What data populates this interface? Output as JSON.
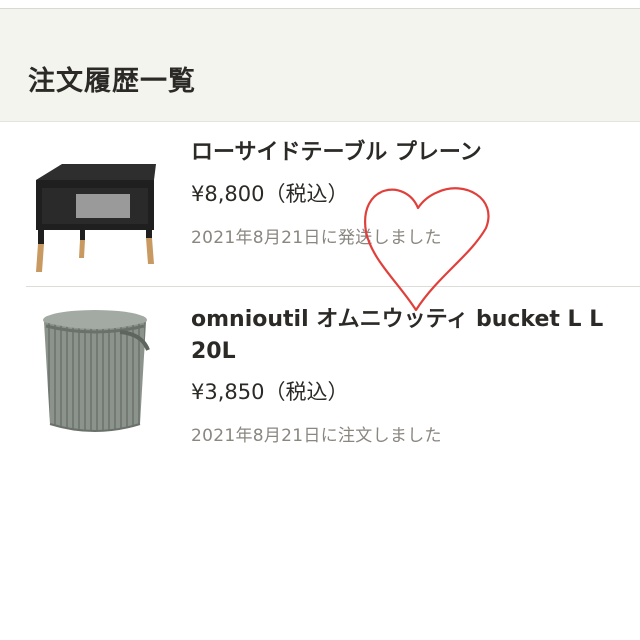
{
  "page": {
    "title": "注文履歴一覧"
  },
  "orders": [
    {
      "name": "ローサイドテーブル プレーン",
      "price": "¥8,800（税込）",
      "status": "2021年8月21日に発送しました",
      "thumbnail_icon": "black-side-table-with-wooden-legs"
    },
    {
      "name": "omnioutil オムニウッティ bucket L L 20L",
      "price": "¥3,850（税込）",
      "status": "2021年8月21日に注文しました",
      "thumbnail_icon": "gray-ribbed-bucket-with-handle"
    }
  ],
  "annotation": {
    "icon": "hand-drawn-heart-icon",
    "color": "#e0403c"
  },
  "colors": {
    "header_background": "#f4f4ef",
    "text": "#2c2a26",
    "muted_text": "#8a8680"
  }
}
